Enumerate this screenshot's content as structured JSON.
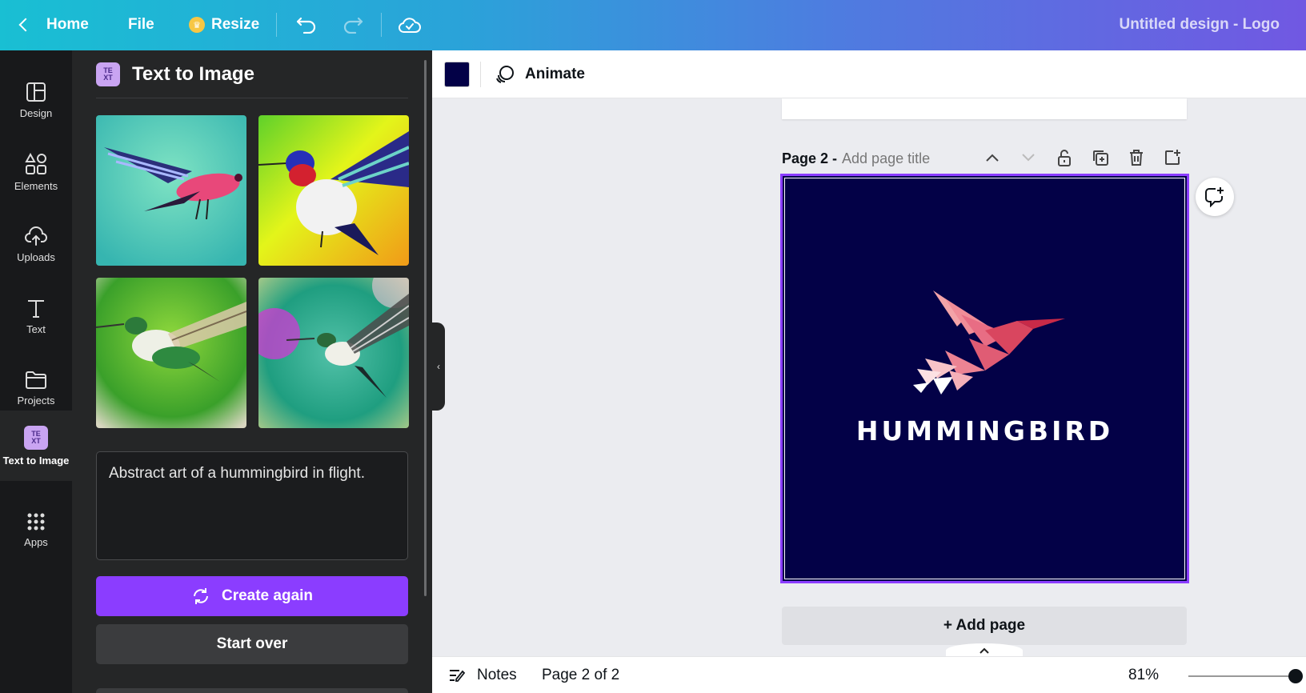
{
  "topbar": {
    "home_label": "Home",
    "file_label": "File",
    "resize_label": "Resize",
    "title": "Untitled design - Logo"
  },
  "rail": {
    "items": [
      {
        "label": "Design",
        "icon": "layout-icon"
      },
      {
        "label": "Elements",
        "icon": "shapes-icon"
      },
      {
        "label": "Uploads",
        "icon": "cloud-upload-icon"
      },
      {
        "label": "Text",
        "icon": "text-icon"
      },
      {
        "label": "Projects",
        "icon": "folder-icon"
      },
      {
        "label": "Text to Image",
        "icon": "text-to-image-icon"
      },
      {
        "label": "Apps",
        "icon": "grid-icon"
      }
    ],
    "active": "Text to Image"
  },
  "panel": {
    "title": "Text to Image",
    "prompt": "Abstract art of a hummingbird in flight.",
    "create_again_label": "Create again",
    "start_over_label": "Start over"
  },
  "context_toolbar": {
    "color": "#030147",
    "animate_label": "Animate"
  },
  "page": {
    "label": "Page 2 -",
    "title_placeholder": "Add page title",
    "logo_text": "HUMMINGBIRD",
    "add_page_label": "+ Add page"
  },
  "bottombar": {
    "notes_label": "Notes",
    "page_count": "Page 2 of 2",
    "zoom": "81%"
  },
  "colors": {
    "accent": "#8b3dff",
    "canvas_bg": "#030147",
    "panel_bg": "#252627",
    "rail_bg": "#18191b"
  }
}
